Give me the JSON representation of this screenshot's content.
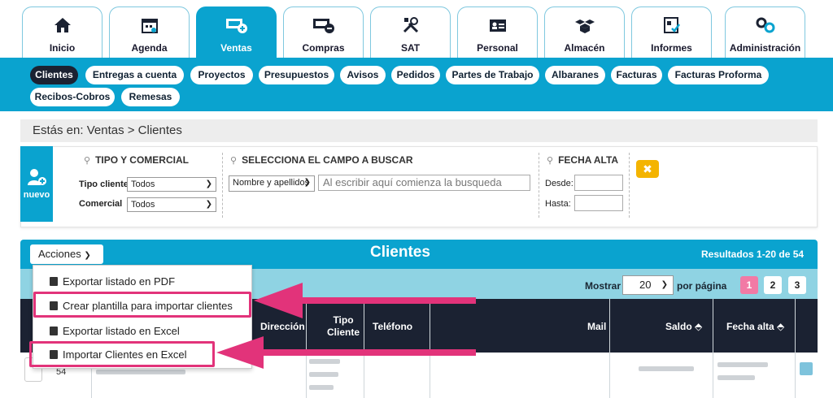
{
  "tabs": [
    {
      "label": "Inicio",
      "icon": "home-icon"
    },
    {
      "label": "Agenda",
      "icon": "calendar-icon"
    },
    {
      "label": "Ventas",
      "icon": "money-plus-icon"
    },
    {
      "label": "Compras",
      "icon": "money-minus-icon"
    },
    {
      "label": "SAT",
      "icon": "tools-icon"
    },
    {
      "label": "Personal",
      "icon": "id-card-icon"
    },
    {
      "label": "Almacén",
      "icon": "boxes-icon"
    },
    {
      "label": "Informes",
      "icon": "report-icon"
    },
    {
      "label": "Administración",
      "icon": "gears-icon"
    }
  ],
  "subnav": [
    "Clientes",
    "Entregas a cuenta",
    "Proyectos",
    "Presupuestos",
    "Avisos",
    "Pedidos",
    "Partes de Trabajo",
    "Albaranes",
    "Facturas",
    "Facturas Proforma",
    "Recibos-Cobros",
    "Remesas"
  ],
  "breadcrumb": "Estás en: Ventas > Clientes",
  "filters": {
    "nuevo": "nuevo",
    "group1_title": "TIPO Y COMERCIAL",
    "tipo_label": "Tipo cliente",
    "tipo_value": "Todos",
    "comercial_label": "Comercial",
    "comercial_value": "Todos",
    "group2_title": "SELECCIONA EL CAMPO A BUSCAR",
    "campo_value": "Nombre y apellidos",
    "search_placeholder": "Al escribir aquí comienza la busqueda",
    "group3_title": "FECHA ALTA",
    "desde_label": "Desde:",
    "hasta_label": "Hasta:"
  },
  "results": {
    "title": "Clientes",
    "count": "Resultados 1-20 de 54",
    "acciones": "Acciones",
    "mostrar": "Mostrar",
    "per_page_value": "20",
    "per_page_label": "por página",
    "pages": [
      "1",
      "2",
      "3"
    ],
    "current_page": "1",
    "columns": {
      "direccion": "Dirección",
      "tipo": "Tipo Cliente",
      "telefono": "Teléfono",
      "mail": "Mail",
      "saldo": "Saldo ⬘",
      "fecha": "Fecha alta ⬘"
    },
    "first_row_id": "54"
  },
  "menu": [
    "Exportar listado en PDF",
    "Crear plantilla para importar clientes",
    "Exportar listado en Excel",
    "Importar Clientes en Excel"
  ],
  "colors": {
    "primary": "#0aa3cf",
    "dark": "#1b2232",
    "highlight": "#e2337a",
    "warning": "#f4b400"
  }
}
